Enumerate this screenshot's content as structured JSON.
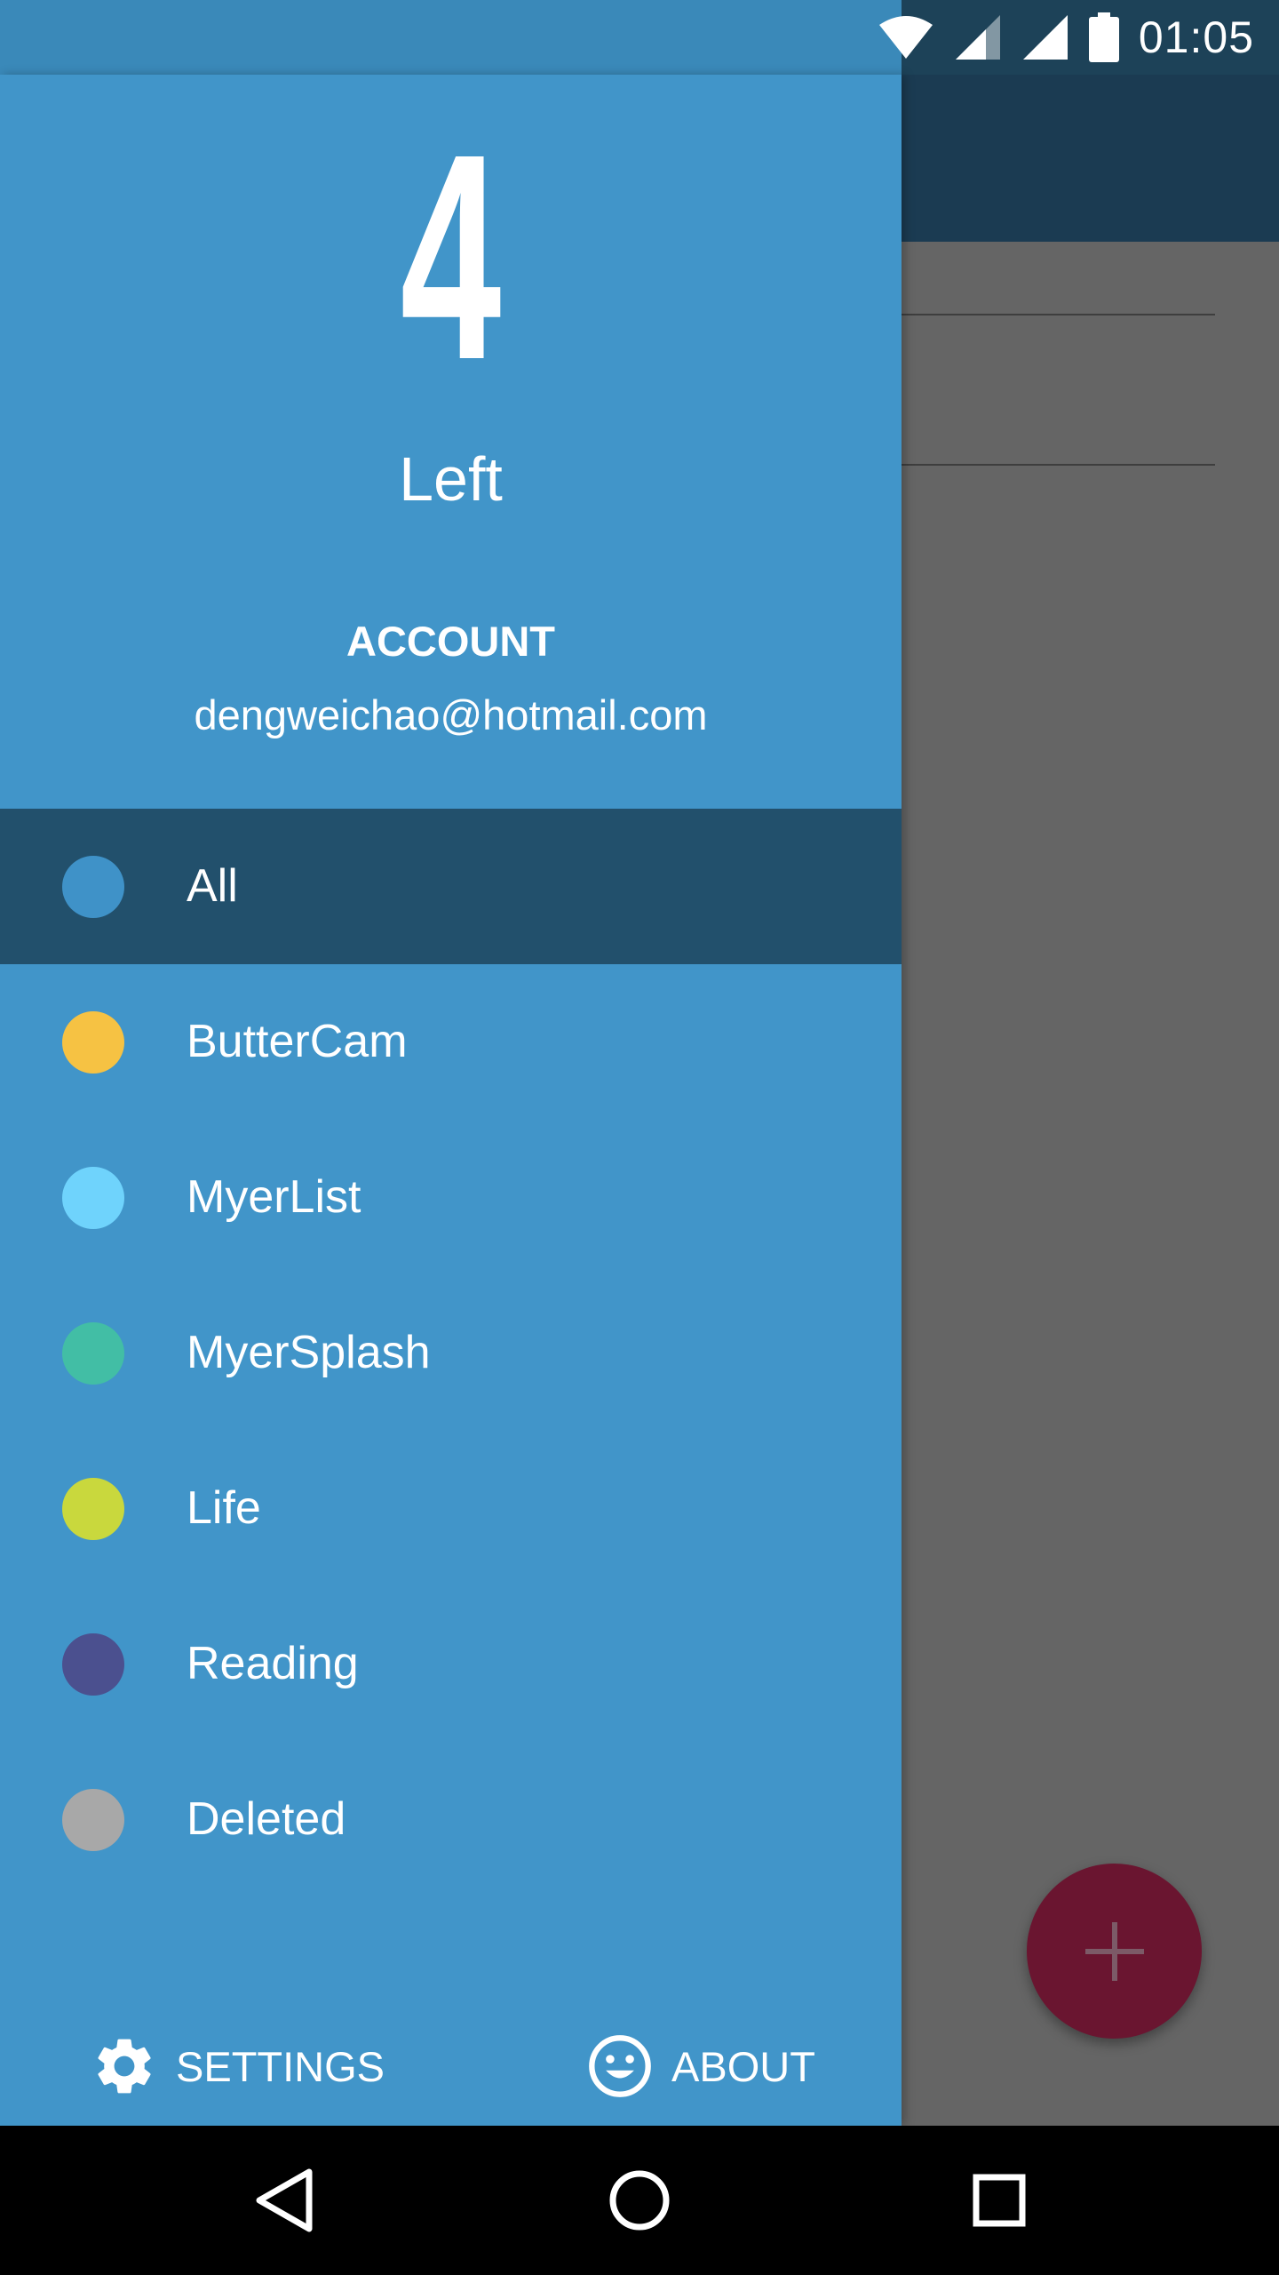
{
  "status_bar": {
    "time": "01:05",
    "icons": [
      "wifi-icon",
      "signal-icon",
      "signal-full-icon",
      "battery-icon"
    ]
  },
  "drawer": {
    "count": "4",
    "count_label": "Left",
    "account_title": "ACCOUNT",
    "account_email": "dengweichao@hotmail.com",
    "categories": [
      {
        "label": "All",
        "color": "#3f92c8",
        "selected": true
      },
      {
        "label": "ButterCam",
        "color": "#f6c243",
        "selected": false
      },
      {
        "label": "MyerList",
        "color": "#6fd3fc",
        "selected": false
      },
      {
        "label": "MyerSplash",
        "color": "#42bea5",
        "selected": false
      },
      {
        "label": "Life",
        "color": "#c9d83d",
        "selected": false
      },
      {
        "label": "Reading",
        "color": "#4b508f",
        "selected": false
      },
      {
        "label": "Deleted",
        "color": "#a8a8a8",
        "selected": false
      }
    ],
    "footer": {
      "settings_label": "SETTINGS",
      "about_label": "ABOUT"
    }
  },
  "fab": {
    "icon": "plus-icon",
    "color": "#6a1530"
  },
  "nav_bar": {
    "buttons": [
      "back-icon",
      "home-icon",
      "recents-icon"
    ]
  },
  "colors": {
    "drawer_bg": "#4195c9",
    "selected_bg": "#22506c",
    "toolbar_bg": "#1b3b52"
  }
}
